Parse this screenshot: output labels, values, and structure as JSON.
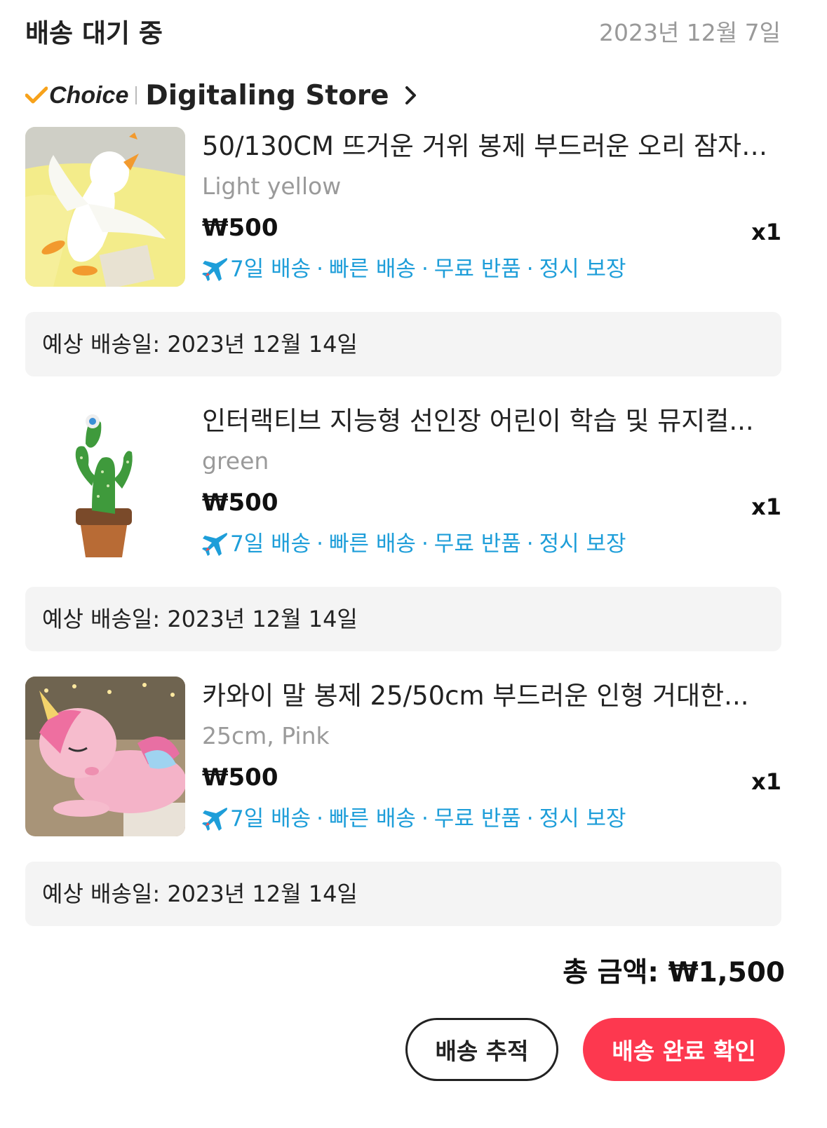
{
  "order": {
    "status": "배송 대기 중",
    "date": "2023년 12월 7일"
  },
  "store": {
    "badge": "Choice",
    "name": "Digitaling Store",
    "icons": {
      "badge": "checkmark-icon",
      "link": "chevron-right-icon"
    }
  },
  "items": [
    {
      "title": "50/130CM 뜨거운 거위 봉제 부드러운 오리 잠자…",
      "variant": "Light yellow",
      "price": "₩500",
      "qty": "x1",
      "image": "white-goose-plush",
      "shipping": {
        "icon": "airplane-icon",
        "tags": [
          "7일 배송",
          "빠른 배송",
          "무료 반품",
          "정시 보장"
        ]
      },
      "delivery": "예상 배송일: 2023년 12월 14일"
    },
    {
      "title": "인터랙티브 지능형 선인장 어린이 학습 및 뮤지컬...",
      "variant": "green",
      "price": "₩500",
      "qty": "x1",
      "image": "dancing-cactus-toy",
      "shipping": {
        "icon": "airplane-icon",
        "tags": [
          "7일 배송",
          "빠른 배송",
          "무료 반품",
          "정시 보장"
        ]
      },
      "delivery": "예상 배송일: 2023년 12월 14일"
    },
    {
      "title": "카와이 말 봉제 25/50cm 부드러운 인형 거대한...",
      "variant": "25cm, Pink",
      "price": "₩500",
      "qty": "x1",
      "image": "pink-unicorn-plush",
      "shipping": {
        "icon": "airplane-icon",
        "tags": [
          "7일 배송",
          "빠른 배송",
          "무료 반품",
          "정시 보장"
        ]
      },
      "delivery": "예상 배송일: 2023년 12월 14일"
    }
  ],
  "summary": {
    "total": "총 금액: ₩1,500"
  },
  "actions": {
    "track": "배송 추적",
    "confirm": "배송 완료 확인"
  },
  "colors": {
    "accent": "#fd384f",
    "shipping": "#1e9ed9",
    "choice_check": "#f7a21b",
    "delivery_bg": "#f4f4f4"
  }
}
